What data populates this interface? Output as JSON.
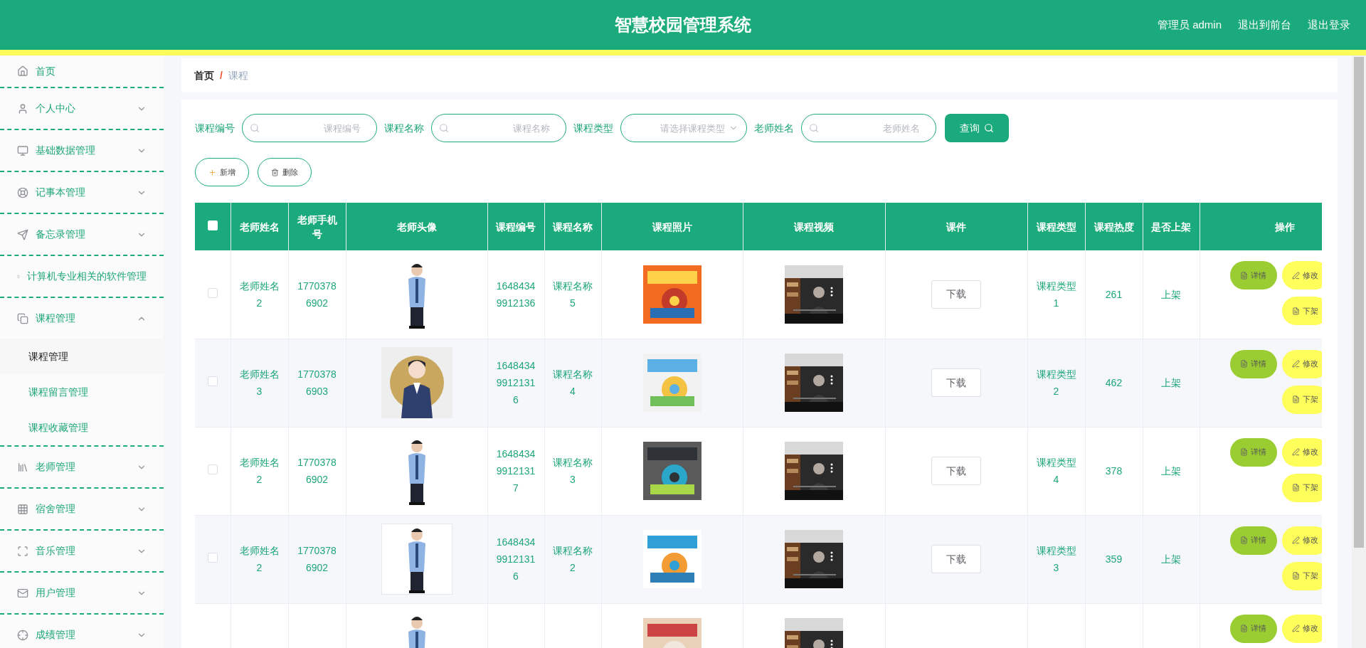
{
  "header": {
    "title": "智慧校园管理系统",
    "links": [
      "管理员 admin",
      "退出到前台",
      "退出登录"
    ]
  },
  "sidebar": {
    "items": [
      {
        "label": "首页"
      },
      {
        "label": "个人中心",
        "expanded": false
      },
      {
        "label": "基础数据管理",
        "expanded": false
      },
      {
        "label": "记事本管理",
        "expanded": false
      },
      {
        "label": "备忘录管理",
        "expanded": false
      },
      {
        "label": "计算机专业相关的软件管理"
      },
      {
        "label": "课程管理",
        "expanded": true,
        "children": [
          {
            "label": "课程管理",
            "selected": true
          },
          {
            "label": "课程留言管理",
            "selected": false
          },
          {
            "label": "课程收藏管理",
            "selected": false
          }
        ]
      },
      {
        "label": "老师管理",
        "expanded": false
      },
      {
        "label": "宿舍管理",
        "expanded": false
      },
      {
        "label": "音乐管理",
        "expanded": false
      },
      {
        "label": "用户管理",
        "expanded": false
      },
      {
        "label": "成绩管理",
        "expanded": false
      }
    ]
  },
  "breadcrumb": [
    "首页",
    "/",
    "课程"
  ],
  "filters": [
    {
      "label": "课程编号",
      "placeholder": "课程编号",
      "kind": "search"
    },
    {
      "label": "课程名称",
      "placeholder": "课程名称",
      "kind": "search"
    },
    {
      "label": "课程类型",
      "placeholder": "请选择课程类型",
      "kind": "select"
    },
    {
      "label": "老师姓名",
      "placeholder": "老师姓名",
      "kind": "search"
    }
  ],
  "query_button": "查询",
  "toolbar": [
    {
      "label": "新增",
      "kind": "add"
    },
    {
      "label": "删除",
      "kind": "delete"
    }
  ],
  "table": {
    "header_checkbox": {
      "checked": false
    },
    "columns": [
      "老师姓名",
      "老师手机号",
      "老师头像",
      "课程编号",
      "课程名称",
      "课程照片",
      "课程视频",
      "课件",
      "课程类型",
      "课程热度",
      "是否上架",
      "操作"
    ],
    "rows": [
      {
        "checked": false,
        "teacher": "老师姓名2",
        "phone": "17703786902",
        "code": "16484349912136",
        "name": "课程名称5",
        "download": "下载",
        "type": "课程类型1",
        "heat": "261",
        "status": "上架",
        "actions": [
          {
            "label": "详情",
            "kind": "detail"
          },
          {
            "label": "修改",
            "kind": "edit"
          },
          {
            "label": "下架",
            "kind": "off"
          }
        ]
      },
      {
        "checked": false,
        "teacher": "老师姓名3",
        "phone": "17703786903",
        "code": "164843499121316",
        "name": "课程名称4",
        "download": "下载",
        "type": "课程类型2",
        "heat": "462",
        "status": "上架",
        "actions": [
          {
            "label": "详情",
            "kind": "detail"
          },
          {
            "label": "修改",
            "kind": "edit"
          },
          {
            "label": "下架",
            "kind": "off"
          }
        ]
      },
      {
        "checked": false,
        "teacher": "老师姓名2",
        "phone": "17703786902",
        "code": "164843499121317",
        "name": "课程名称3",
        "download": "下载",
        "type": "课程类型4",
        "heat": "378",
        "status": "上架",
        "actions": [
          {
            "label": "详情",
            "kind": "detail"
          },
          {
            "label": "修改",
            "kind": "edit"
          },
          {
            "label": "下架",
            "kind": "off"
          }
        ]
      },
      {
        "checked": false,
        "teacher": "老师姓名2",
        "phone": "17703786902",
        "code": "164843499121316",
        "name": "课程名称2",
        "download": "下载",
        "type": "课程类型3",
        "heat": "359",
        "status": "上架",
        "actions": [
          {
            "label": "详情",
            "kind": "detail"
          },
          {
            "label": "修改",
            "kind": "edit"
          },
          {
            "label": "下架",
            "kind": "off"
          }
        ]
      },
      {
        "actions": [
          {
            "label": "详情",
            "kind": "detail"
          },
          {
            "label": "修改",
            "kind": "edit"
          }
        ]
      }
    ]
  }
}
